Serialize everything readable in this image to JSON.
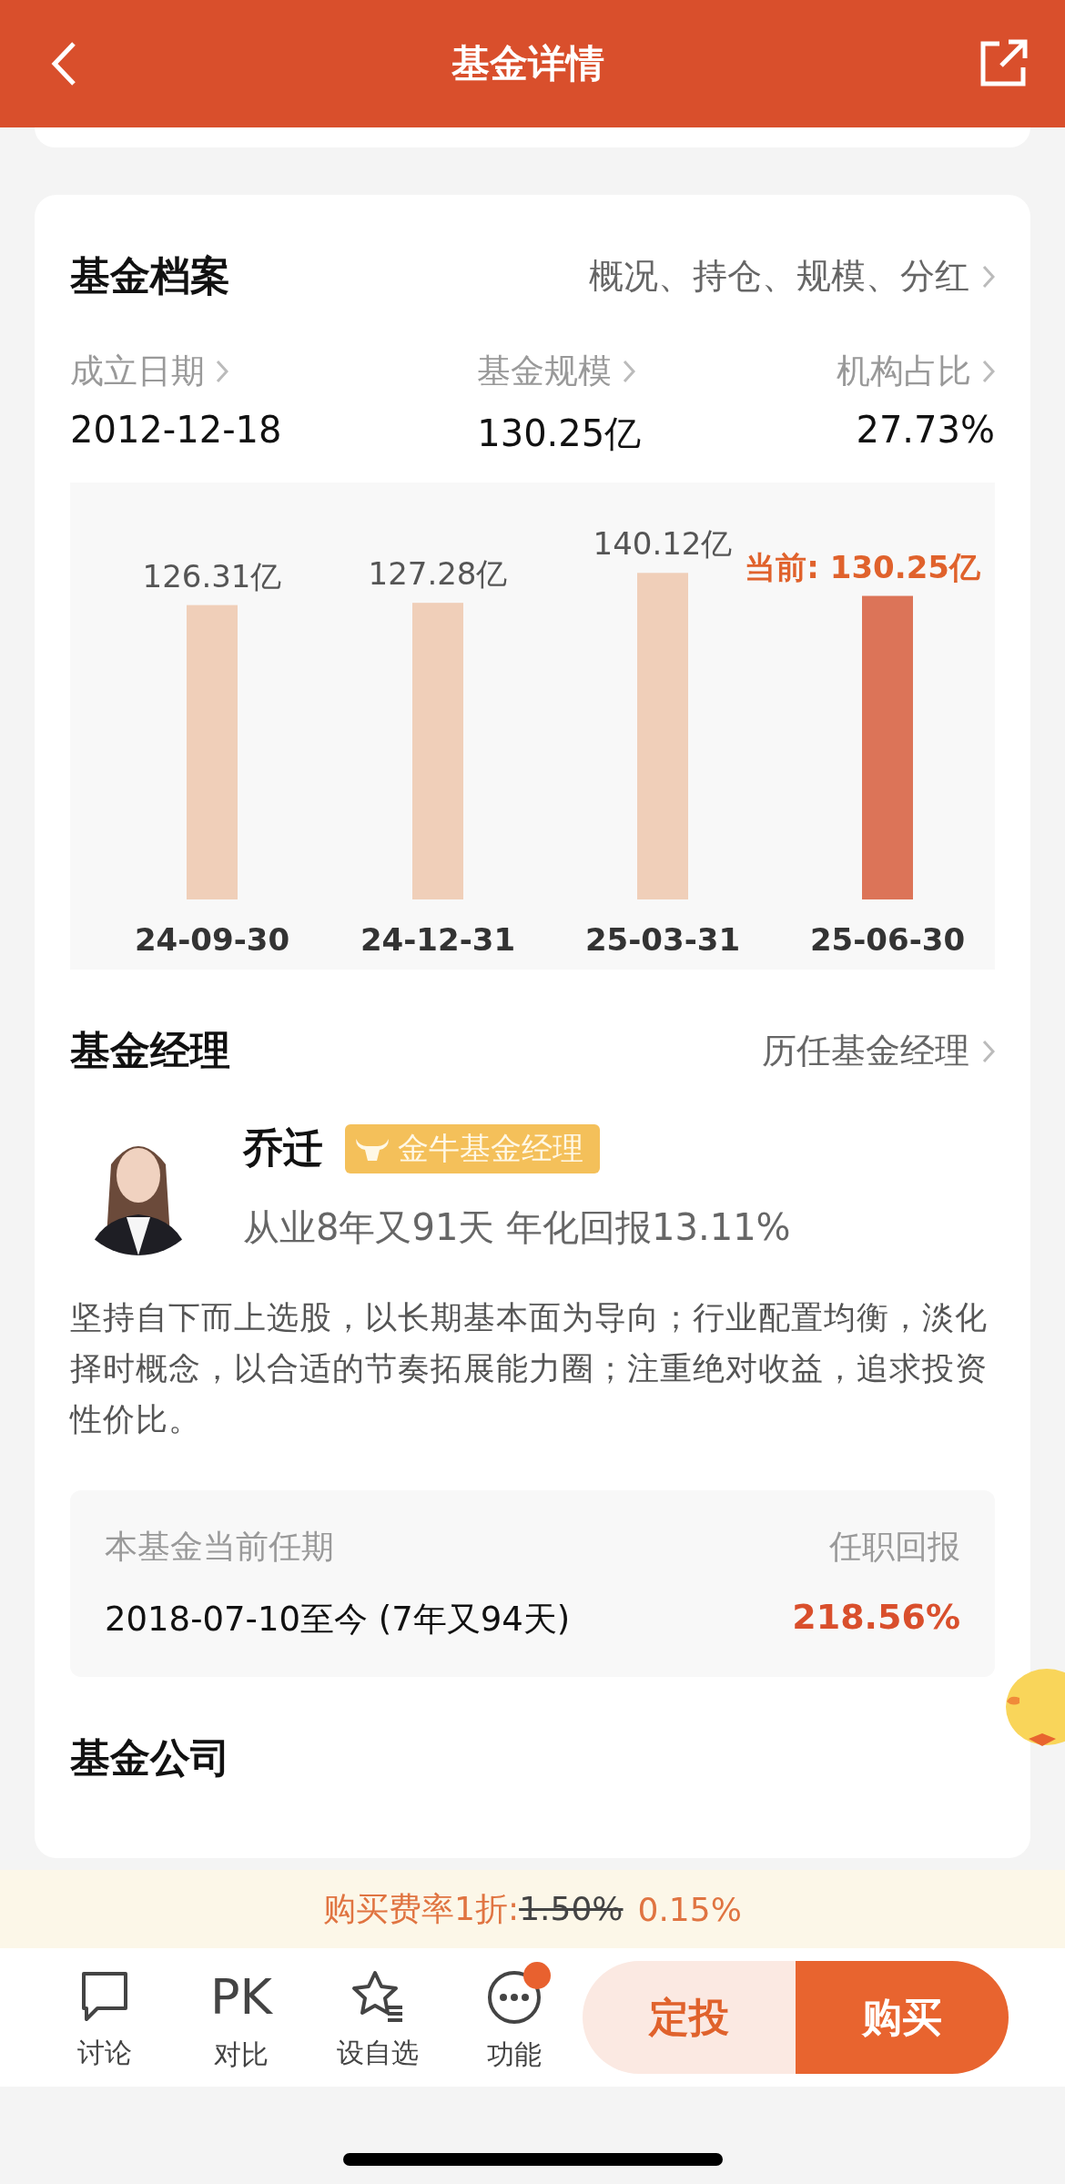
{
  "header": {
    "title": "基金详情"
  },
  "profile": {
    "title": "基金档案",
    "link": "概况、持仓、规模、分红",
    "stats": [
      {
        "label": "成立日期",
        "value": "2012-12-18"
      },
      {
        "label": "基金规模",
        "value": "130.25亿"
      },
      {
        "label": "机构占比",
        "value": "27.73%"
      }
    ],
    "chart_data": {
      "type": "bar",
      "categories": [
        "24-09-30",
        "24-12-31",
        "25-03-31",
        "25-06-30"
      ],
      "values": [
        126.31,
        127.28,
        140.12,
        130.25
      ],
      "value_labels": [
        "126.31亿",
        "127.28亿",
        "140.12亿",
        "当前: 130.25亿"
      ]
    },
    "bars": [
      {
        "selected": false,
        "color": "#f0cfb9"
      },
      {
        "selected": false,
        "color": "#f0cfb9"
      },
      {
        "selected": false,
        "color": "#f0cfb9"
      },
      {
        "selected": true,
        "color": "#dc7458"
      }
    ]
  },
  "manager_section": {
    "title": "基金经理",
    "link": "历任基金经理",
    "manager": {
      "name": "乔迁",
      "badge": "金牛基金经理",
      "summary": "从业8年又91天 年化回报13.11%",
      "description": "坚持自下而上选股，以长期基本面为导向；行业配置均衡，淡化择时概念，以合适的节奏拓展能力圈；注重绝对收益，追求投资性价比。"
    },
    "tenure": {
      "label": "本基金当前任期",
      "period": "2018-07-10至今 (7年又94天)",
      "return_label": "任职回报",
      "return_value": "218.56%"
    }
  },
  "company_section": {
    "title": "基金公司"
  },
  "fee_banner": {
    "label": "购买费率1折:",
    "original": "1.50%",
    "discounted": "0.15%"
  },
  "toolbar": {
    "items": [
      {
        "kind": "chat",
        "label": "讨论",
        "dot": false
      },
      {
        "kind": "pk",
        "icon_text": "PK",
        "label": "对比",
        "dot": false
      },
      {
        "kind": "star",
        "label": "设自选",
        "dot": false
      },
      {
        "kind": "more",
        "label": "功能",
        "dot": true
      }
    ],
    "buttons": [
      {
        "kind": "secondary",
        "label": "定投"
      },
      {
        "kind": "primary",
        "label": "购买"
      }
    ]
  }
}
